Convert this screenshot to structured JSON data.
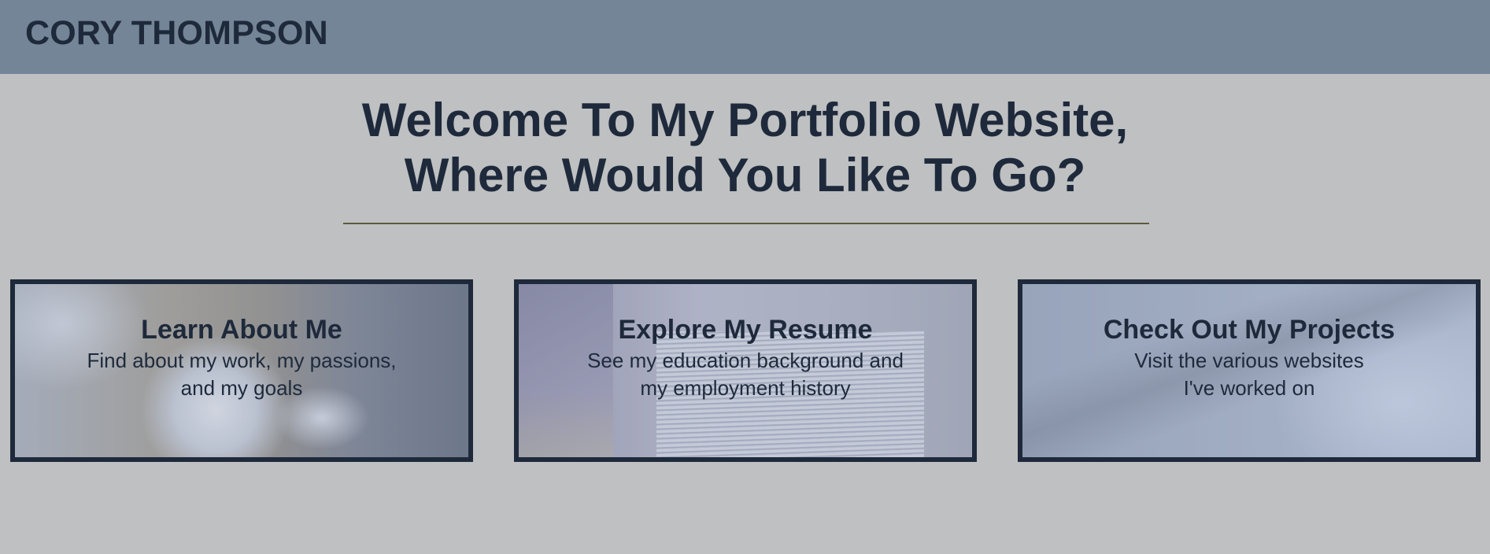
{
  "header": {
    "brand": "CORY THOMPSON"
  },
  "hero": {
    "title_line1": "Welcome To My Portfolio Website,",
    "title_line2": "Where Would You Like To Go?"
  },
  "cards": [
    {
      "title": "Learn About Me",
      "desc_line1": "Find about my work, my passions,",
      "desc_line2": "and my goals"
    },
    {
      "title": "Explore My Resume",
      "desc_line1": "See my education background and",
      "desc_line2": "my employment history"
    },
    {
      "title": "Check Out My Projects",
      "desc_line1": "Visit the various websites",
      "desc_line2": "I've worked on"
    }
  ],
  "colors": {
    "header_bg": "#748597",
    "page_bg": "#bfc0c1",
    "text": "#1e2a3b",
    "divider": "#5d5a40"
  }
}
